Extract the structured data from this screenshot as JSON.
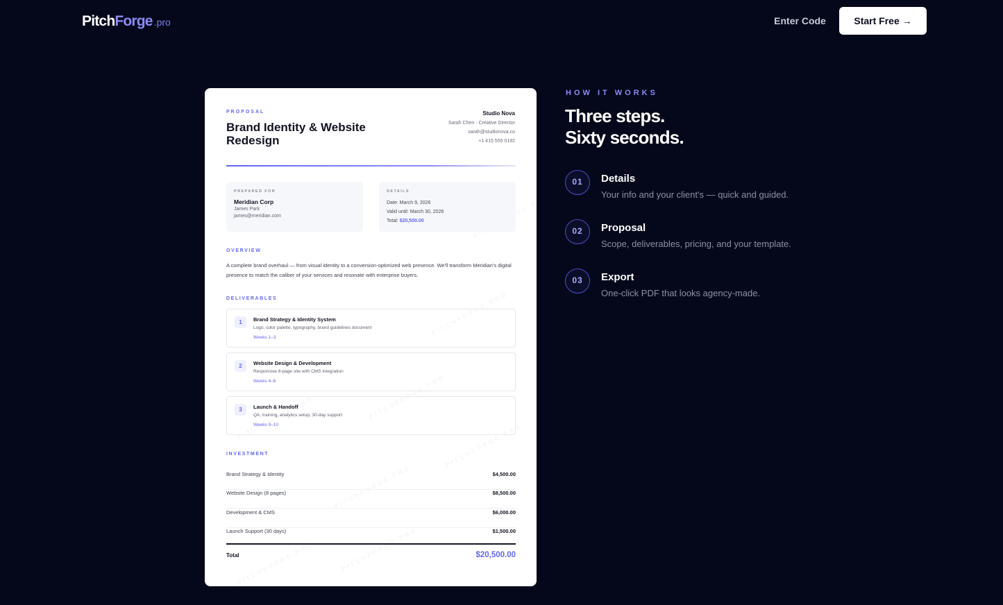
{
  "nav": {
    "logo_pitch": "Pitch",
    "logo_forge": "Forge",
    "logo_pro": ".pro",
    "enter_code": "Enter Code",
    "start_free": "Start Free →"
  },
  "document": {
    "eyebrow": "PROPOSAL",
    "title": "Brand Identity & Website Redesign",
    "studio": {
      "name": "Studio Nova",
      "contact": "Sarah Chen · Creative Director",
      "email": "sarah@studionova.co",
      "phone": "+1 415 555 0192"
    },
    "prepared_for": {
      "label": "PREPARED FOR",
      "company": "Meridian Corp",
      "person": "James Park",
      "email": "james@meridian.com"
    },
    "details": {
      "label": "DETAILS",
      "date": "Date: March 9, 2026",
      "valid": "Valid until: March 30, 2026",
      "total_label": "Total: ",
      "total_value": "$20,500.00"
    },
    "overview_label": "OVERVIEW",
    "overview_text": "A complete brand overhaul — from visual identity to a conversion-optimized web presence. We'll transform Meridian's digital presence to match the caliber of your services and resonate with enterprise buyers.",
    "deliverables_label": "DELIVERABLES",
    "deliverables": [
      {
        "num": "1",
        "title": "Brand Strategy & Identity System",
        "desc": "Logo, color palette, typography, brand guidelines document",
        "weeks": "Weeks 1–3"
      },
      {
        "num": "2",
        "title": "Website Design & Development",
        "desc": "Responsive 8-page site with CMS integration",
        "weeks": "Weeks 4–8"
      },
      {
        "num": "3",
        "title": "Launch & Handoff",
        "desc": "QA, training, analytics setup, 30-day support",
        "weeks": "Weeks 9–10"
      }
    ],
    "investment_label": "INVESTMENT",
    "investment": [
      {
        "item": "Brand Strategy & Identity",
        "amount": "$4,500.00"
      },
      {
        "item": "Website Design (8 pages)",
        "amount": "$8,500.00"
      },
      {
        "item": "Development & CMS",
        "amount": "$6,000.00"
      },
      {
        "item": "Launch Support (30 days)",
        "amount": "$1,500.00"
      }
    ],
    "total_label": "Total",
    "total_amount": "$20,500.00",
    "watermark": "PITCHFORGE.PRO"
  },
  "how_it_works": {
    "eyebrow": "HOW IT WORKS",
    "title_line1": "Three steps.",
    "title_line2": "Sixty seconds.",
    "steps": [
      {
        "num": "01",
        "title": "Details",
        "desc": "Your info and your client's — quick and guided."
      },
      {
        "num": "02",
        "title": "Proposal",
        "desc": "Scope, deliverables, pricing, and your template."
      },
      {
        "num": "03",
        "title": "Export",
        "desc": "One-click PDF that looks agency-made."
      }
    ]
  },
  "colors": {
    "background": "#05081a",
    "accent": "#6366f1",
    "accent_light": "#8b8cf8"
  }
}
